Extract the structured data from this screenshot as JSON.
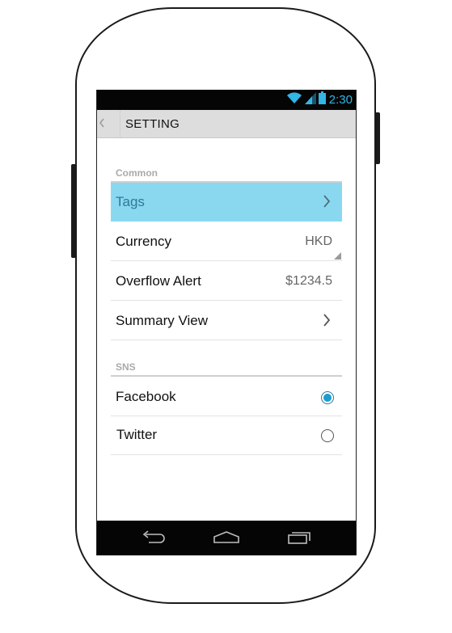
{
  "status_bar": {
    "time": "2:30"
  },
  "action_bar": {
    "title": "SETTING"
  },
  "sections": {
    "common": {
      "header": "Common",
      "rows": [
        {
          "label": "Tags",
          "value": "",
          "kind": "chevron"
        },
        {
          "label": "Currency",
          "value": "HKD",
          "kind": "spinner"
        },
        {
          "label": "Overflow Alert",
          "value": "$1234.5",
          "kind": "value"
        },
        {
          "label": "Summary View",
          "value": "",
          "kind": "chevron"
        }
      ]
    },
    "sns": {
      "header": "SNS",
      "options": [
        {
          "label": "Facebook",
          "checked": true
        },
        {
          "label": "Twitter",
          "checked": false
        }
      ]
    }
  },
  "colors": {
    "accent": "#33b5e5",
    "highlight": "#8ad8f0",
    "radio": "#1e9bd0"
  },
  "icons": [
    "wifi-icon",
    "signal-icon",
    "battery-icon",
    "back-chevron-icon",
    "chevron-right-icon",
    "nav-back-icon",
    "nav-home-icon",
    "nav-recents-icon"
  ]
}
